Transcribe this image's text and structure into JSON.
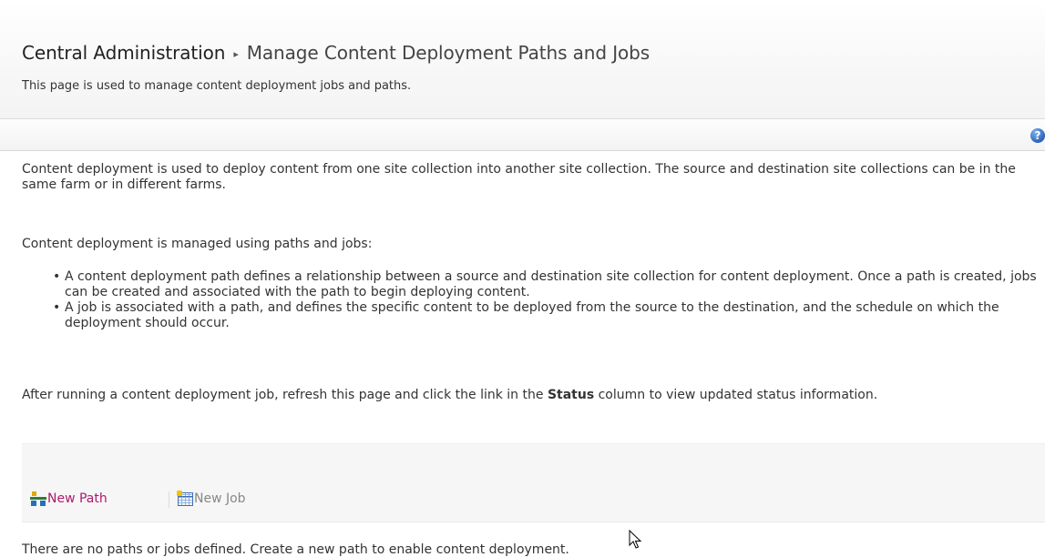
{
  "breadcrumb": {
    "root": "Central Administration",
    "separator": "▸",
    "current": "Manage Content Deployment Paths and Jobs"
  },
  "page_description": "This page is used to manage content deployment jobs and paths.",
  "help_icon": {
    "icon": "help-icon",
    "glyph": "?"
  },
  "content": {
    "intro": "Content deployment is used to deploy content from one site collection into another site collection. The source and destination site collections can be in the same farm or in different farms.",
    "managed_text": "Content deployment is managed using paths and jobs:",
    "bullets": [
      "A content deployment path defines a relationship between a source and destination site collection for content deployment. Once a path is created, jobs can be created and associated with the path to begin deploying content.",
      "A job is associated with a path, and defines the specific content to be deployed from the source to the destination, and the schedule on which the deployment should occur."
    ],
    "status_prefix": "After running a content deployment job, refresh this page and click the link in the ",
    "status_bold": "Status",
    "status_suffix": " column to view updated status information."
  },
  "toolbar": {
    "new_path_label": "New Path",
    "new_path_icon": "new-path-icon",
    "new_job_label": "New Job",
    "new_job_icon": "new-job-icon"
  },
  "empty_message": "There are no paths or jobs defined. Create a new path to enable content deployment.",
  "colors": {
    "link": "#b0196b",
    "disabled": "#888888",
    "text": "#333333",
    "help_blue": "#2a64b8"
  }
}
